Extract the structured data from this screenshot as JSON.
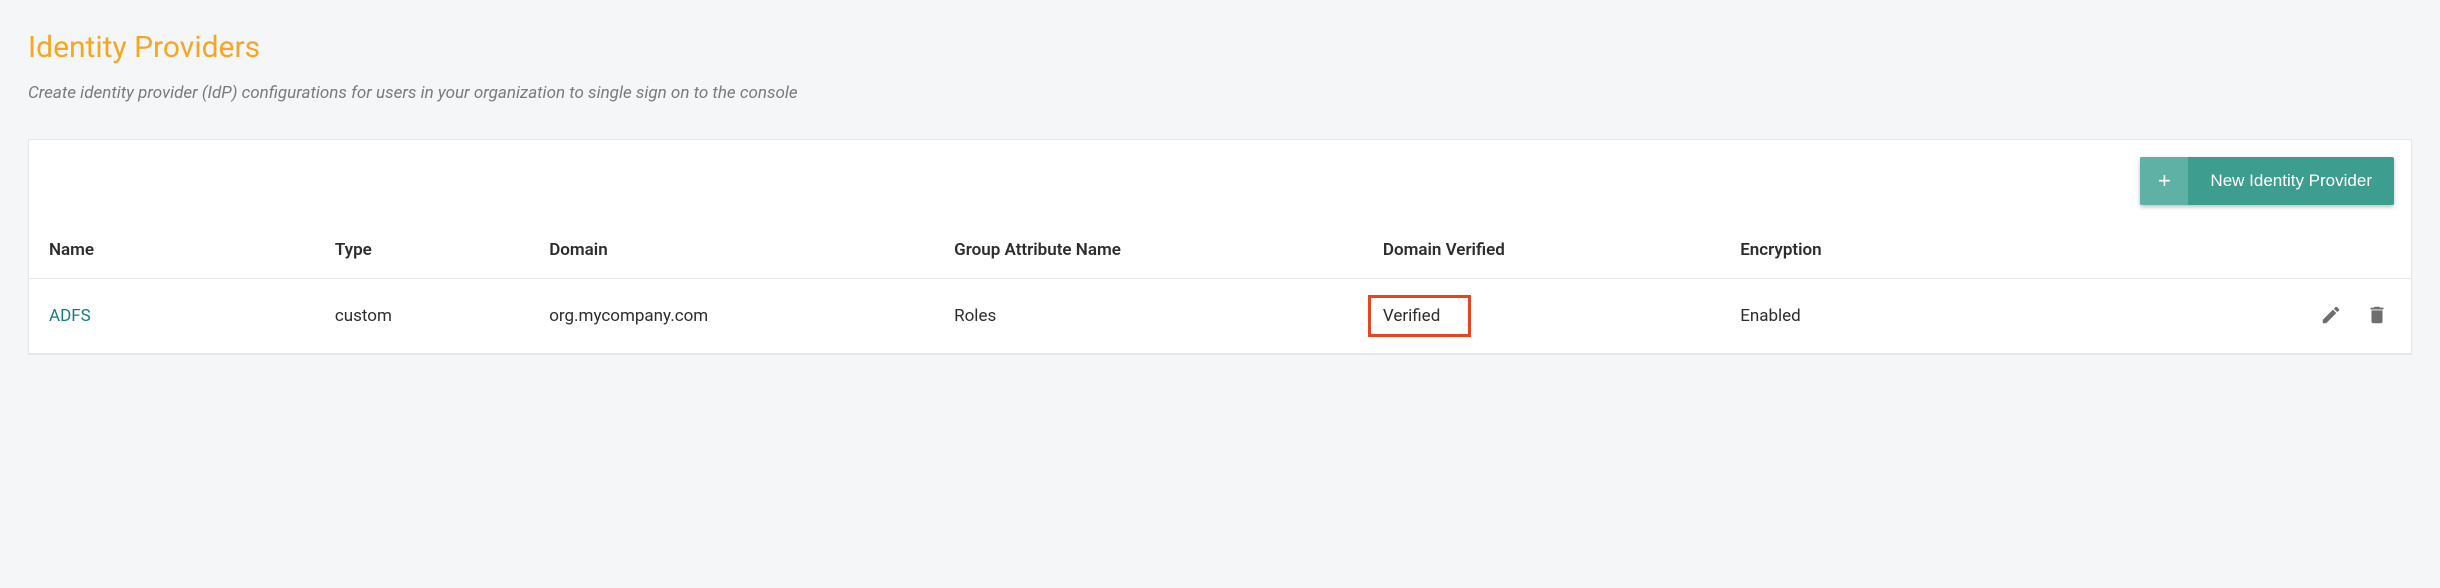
{
  "header": {
    "title": "Identity Providers",
    "description": "Create identity provider (IdP) configurations for users in your organization to single sign on to the console"
  },
  "toolbar": {
    "new_button_label": "New Identity Provider"
  },
  "table": {
    "columns": {
      "name": "Name",
      "type": "Type",
      "domain": "Domain",
      "group_attribute": "Group Attribute Name",
      "domain_verified": "Domain Verified",
      "encryption": "Encryption"
    },
    "rows": [
      {
        "name": "ADFS",
        "type": "custom",
        "domain": "org.mycompany.com",
        "group_attribute": "Roles",
        "domain_verified": "Verified",
        "encryption": "Enabled"
      }
    ]
  }
}
